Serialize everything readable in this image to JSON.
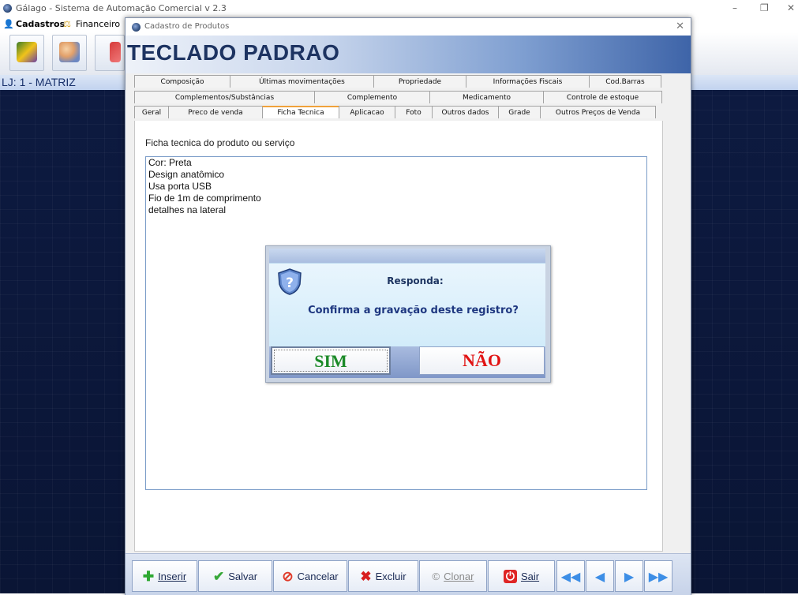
{
  "app": {
    "title": "Gálago - Sistema de Automação Comercial v 2.3",
    "minimize": "–",
    "maximize": "❐",
    "close": "✕"
  },
  "menu": {
    "cadastros": "Cadastros",
    "financeiro": "Financeiro"
  },
  "store": {
    "label": "LJ: 1 - MATRIZ"
  },
  "window": {
    "title": "Cadastro de Produtos",
    "close": "✕",
    "product_name": "TECLADO PADRAO"
  },
  "tabs": {
    "row1": [
      "Composição",
      "Últimas movimentações",
      "Propriedade",
      "Informações Fiscais",
      "Cod.Barras"
    ],
    "row2": [
      "Complementos/Substâncias",
      "Complemento",
      "Medicamento",
      "Controle de estoque"
    ],
    "row3": [
      "Geral",
      "Preco de venda",
      "Ficha Tecnica",
      "Aplicacao",
      "Foto",
      "Outros dados",
      "Grade",
      "Outros Preços de Venda"
    ],
    "active": "Ficha Tecnica"
  },
  "ficha": {
    "caption": "Ficha tecnica do produto ou serviço",
    "lines": [
      "Cor: Preta",
      "Design anatômico",
      "Usa porta USB",
      "Fio de 1m de comprimento",
      "detalhes na lateral"
    ]
  },
  "buttons": {
    "inserir": "Inserir",
    "salvar": "Salvar",
    "cancelar": "Cancelar",
    "excluir": "Excluir",
    "clonar": "Clonar",
    "sair": "Sair"
  },
  "dialog": {
    "heading": "Responda:",
    "message": "Confirma a gravação deste registro?",
    "yes": "SIM",
    "no": "NÃO"
  }
}
